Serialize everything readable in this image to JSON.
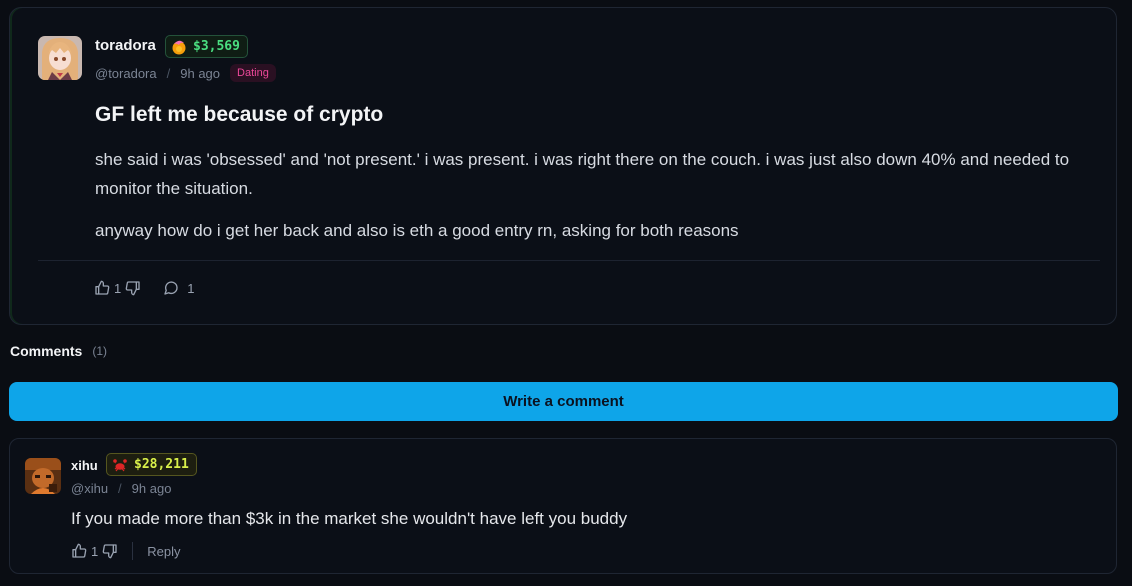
{
  "post": {
    "author": {
      "username": "toradora",
      "handle": "@toradora",
      "balance": "$3,569",
      "avatar_icon": "anime-girl-avatar"
    },
    "time_ago": "9h ago",
    "separator": "/",
    "category": "Dating",
    "title": "GF left me because of crypto",
    "paragraphs": [
      "she said i was 'obsessed' and 'not present.' i was present. i was right there on the couch. i was just also down 40% and needed to monitor the situation.",
      "anyway how do i get her back and also is eth a good entry rn, asking for both reasons"
    ],
    "likes": "1",
    "comments_count": "1"
  },
  "comments_section": {
    "title": "Comments",
    "count": "(1)",
    "write_button": "Write a comment"
  },
  "comment": {
    "author": {
      "username": "xihu",
      "handle": "@xihu",
      "balance": "$28,211",
      "avatar_icon": "character-avatar"
    },
    "time_ago": "9h ago",
    "separator": "/",
    "text": "If you made more than $3k in the market she wouldn't have left you buddy",
    "likes": "1",
    "reply_label": "Reply"
  },
  "colors": {
    "accent": "#0ea5e9",
    "balance_green": "#4ade80",
    "balance_yellow": "#d9f04a",
    "tag_pink": "#ec4899"
  }
}
